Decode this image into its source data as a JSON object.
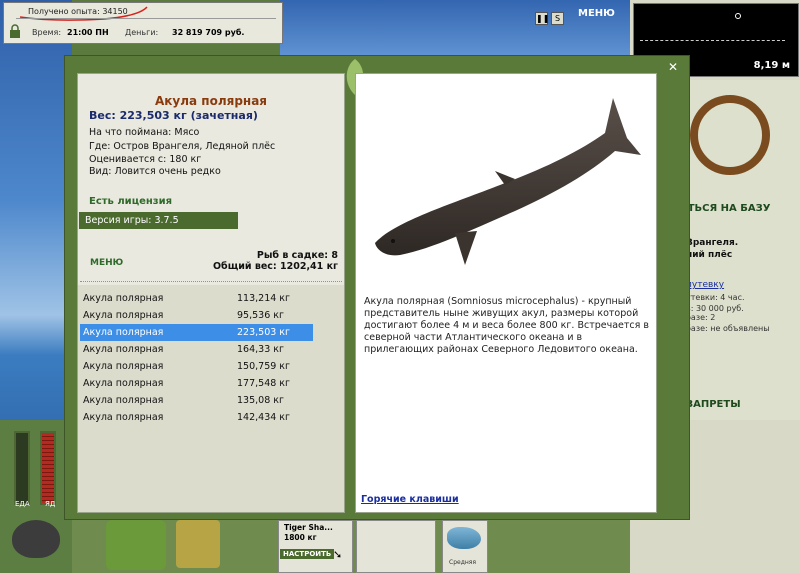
{
  "hud": {
    "xp_text": "Получено опыта: 34150",
    "time_label": "Время:",
    "time_value": "21:00 ПН",
    "money_label": "Деньги:",
    "money_value": "32 819 709 руб.",
    "menu_label": "МЕНЮ"
  },
  "map": {
    "depth": "8,19 м"
  },
  "right_panel": {
    "base_label": "УТЬСЯ НА БАЗУ",
    "location_line1": "Врангеля.",
    "location_line2": "ний плёс",
    "voucher_link": "путевку",
    "trip_line": "утевки: 4 час.",
    "price_line": "ь: 30 000 руб.",
    "base_line": "базе: 2",
    "notice_line": "базе: не объявлены",
    "bans_label": "ЗАПРЕТЫ"
  },
  "fish": {
    "title": "Акула полярная",
    "weight_text": "Вес: 223,503 кг (зачетная)",
    "caught_on": "На что поймана: Мясо",
    "location": "Где: Остров Врангеля, Ледяной плёс",
    "valued_from": "Оценивается с: 180 кг",
    "view": "Вид: Ловится очень редко",
    "license": "Есть лицензия",
    "version": "Версия игры: 3.7.5",
    "menu_label": "МЕНЮ",
    "cage_count": "Рыб в садке: 8",
    "total_weight": "Общий вес: 1202,41 кг",
    "description": "Акула полярная (Somniosus microcephalus) - крупный представитель ныне живущих акул, размеры которой достигают более 4 м и веса более 800 кг. Встречается в северной части Атлантического океана и в прилегающих районах Северного Ледовитого океана.",
    "hotkeys": "Горячие клавиши"
  },
  "catch_list": [
    {
      "name": "Акула полярная",
      "weight": "113,214 кг",
      "selected": false
    },
    {
      "name": "Акула полярная",
      "weight": "95,536 кг",
      "selected": false
    },
    {
      "name": "Акула полярная",
      "weight": "223,503 кг",
      "selected": true
    },
    {
      "name": "Акула полярная",
      "weight": "164,33 кг",
      "selected": false
    },
    {
      "name": "Акула полярная",
      "weight": "150,759 кг",
      "selected": false
    },
    {
      "name": "Акула полярная",
      "weight": "177,548 кг",
      "selected": false
    },
    {
      "name": "Акула полярная",
      "weight": "135,08 кг",
      "selected": false
    },
    {
      "name": "Акула полярная",
      "weight": "142,434 кг",
      "selected": false
    }
  ],
  "bottom": {
    "meter_food": "ЕДА",
    "meter_poison": "ЯД",
    "lure_name": "Tiger Sha...",
    "lure_weight": "1800 кг",
    "configure": "НАСТРОИТЬ",
    "level": "Средняя"
  },
  "colors": {
    "selected_row": "#3c8ee6",
    "title": "#8a3b0e",
    "frame": "#5a7a3a"
  }
}
